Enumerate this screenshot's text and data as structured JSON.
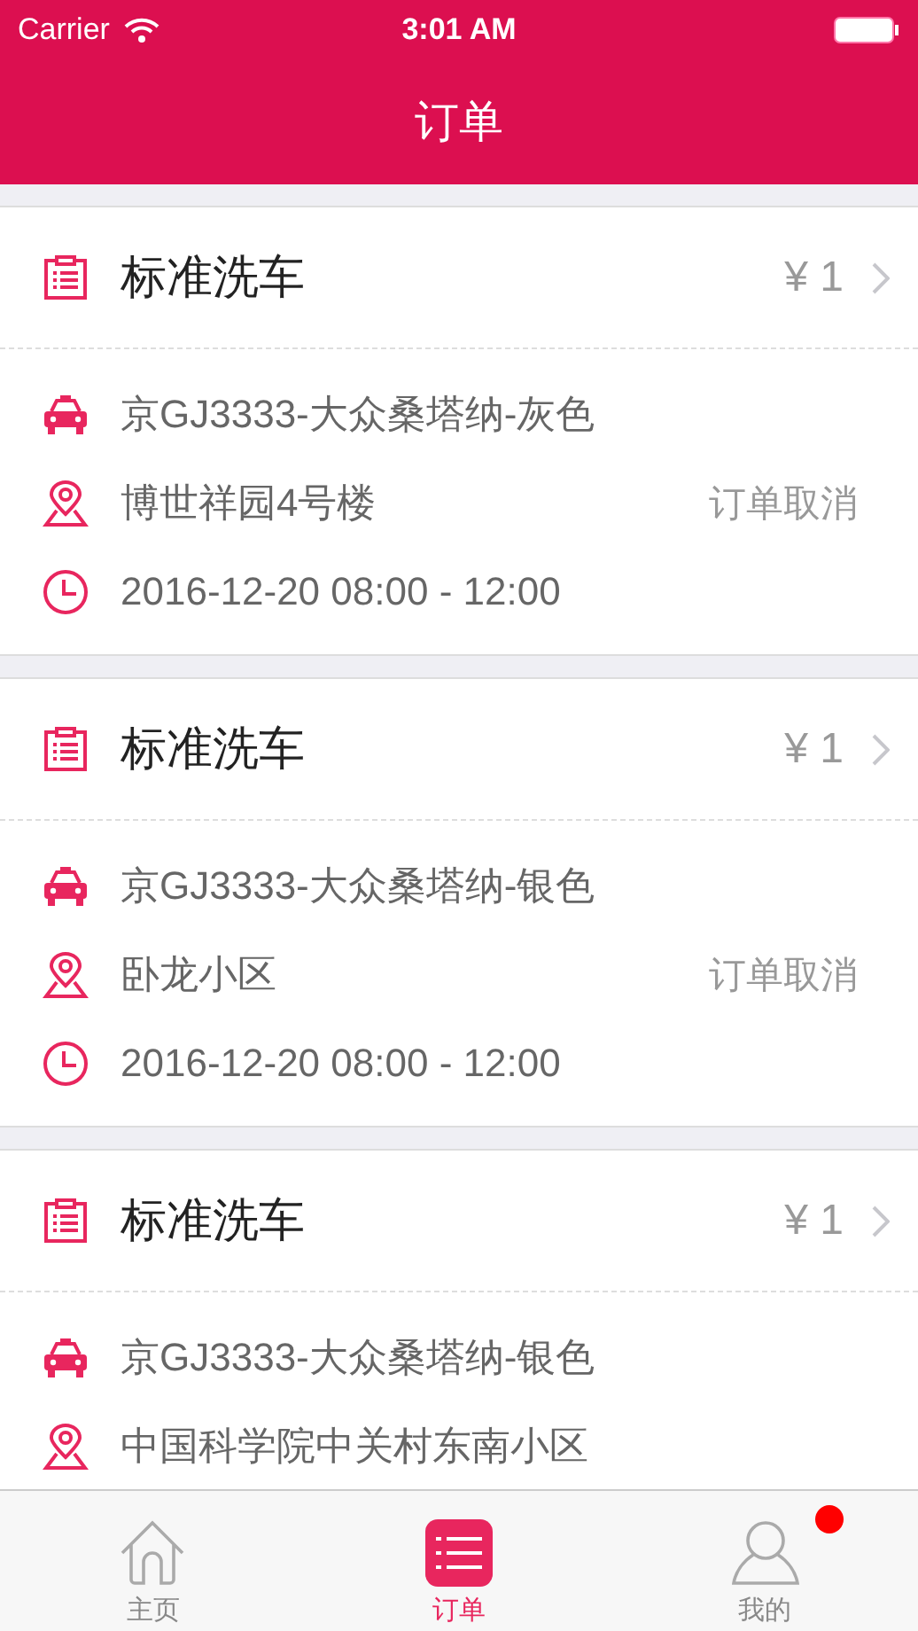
{
  "status_bar": {
    "carrier": "Carrier",
    "time": "3:01 AM"
  },
  "nav_bar": {
    "title": "订单"
  },
  "orders": [
    {
      "title": "标准洗车",
      "price": "¥ 1",
      "car": "京GJ3333-大众桑塔纳-灰色",
      "address": "博世祥园4号楼",
      "action": "订单取消",
      "time": "2016-12-20 08:00 - 12:00"
    },
    {
      "title": "标准洗车",
      "price": "¥ 1",
      "car": "京GJ3333-大众桑塔纳-银色",
      "address": "卧龙小区",
      "action": "订单取消",
      "time": "2016-12-20 08:00 - 12:00"
    },
    {
      "title": "标准洗车",
      "price": "¥ 1",
      "car": "京GJ3333-大众桑塔纳-银色",
      "address": "中国科学院中关村东南小区"
    }
  ],
  "tab_bar": [
    {
      "kind": "home",
      "label": "主页",
      "selected": false,
      "badge": false
    },
    {
      "kind": "orders",
      "label": "订单",
      "selected": true,
      "badge": false
    },
    {
      "kind": "profile",
      "label": "我的",
      "selected": false,
      "badge": true
    }
  ]
}
